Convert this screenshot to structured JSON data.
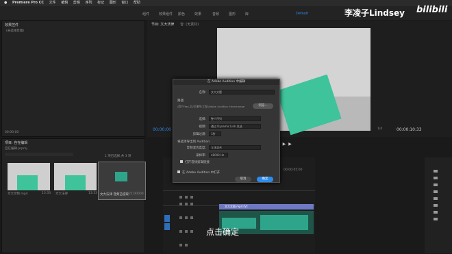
{
  "menubar": {
    "app": "Premiere Pro CC",
    "items": [
      "文件",
      "编辑",
      "剪辑",
      "序列",
      "标记",
      "图形",
      "窗口",
      "帮助"
    ]
  },
  "workspaces": [
    "组件",
    "效果组件",
    "颜色",
    "效果",
    "音频",
    "图形",
    "库",
    "Default"
  ],
  "watermark": {
    "name": "李凌子Lindsey",
    "brand": "bilibili"
  },
  "source_panel": {
    "title": "效果控件",
    "placeholder": "(未选择剪辑)"
  },
  "program_tabs": {
    "program": "节目: 文大法律",
    "audio": "音: (无素材)"
  },
  "timecodes": {
    "left": "00:00:00",
    "program_end": "00:00:10:33",
    "fit": "1/4"
  },
  "project_panel": {
    "title": "项目: 自在编辑",
    "path": "自在编辑.prproj",
    "count": "1 项已选择,共 3 项",
    "clips": [
      {
        "name": "文大文物.mp4",
        "duration": "13:33"
      },
      {
        "name": "文大法律",
        "duration": "13:33"
      },
      {
        "name": "文大法律 音频已提取",
        "duration": "21:00000"
      }
    ]
  },
  "dialog": {
    "title": "在 Adobe Audition 中编辑",
    "name_label": "名称:",
    "name_value": "文大文题",
    "path_label": "路径:",
    "path_value": "/用户/Yao_后/文事件/工程/Adobe Audition Interchange",
    "browse": "浏览...",
    "select_label": "选择:",
    "select_value": "整个序列",
    "video_label": "视频:",
    "video_value": "通过 Dynamic Link 发送",
    "handles_label": "剪辑过渡:",
    "handles_value": "1秒",
    "audio_label": "将选项导出到 Audition",
    "format_label": "音频混合类型:",
    "format_value": "立体混合",
    "sample_label": "采样率:",
    "sample_value": "48000 Hz",
    "check1": "打开音频剪辑链接",
    "check2": "在 Adobe Audition 中打开",
    "cancel": "取消",
    "ok": "确定"
  },
  "timeline": {
    "ruler": [
      "00:00",
      "00:00:05:00",
      "00:00:10:00",
      "00:00:15:00",
      "00:00:20:00"
    ],
    "clip_label": "文大文图.mp4 [V]",
    "subtitle": "点击确定"
  },
  "colors": {
    "accent": "#2d8ceb",
    "clip_video": "#6f78c2",
    "clip_audio": "#2ea58a"
  }
}
